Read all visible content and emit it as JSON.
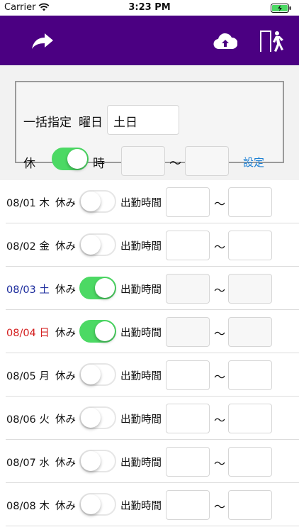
{
  "status_bar": {
    "carrier": "Carrier",
    "time": "3:23 PM"
  },
  "navbar": {
    "bg": "#4b0082",
    "icons": [
      "share-forward-icon",
      "cloud-upload-icon",
      "exit-door-icon"
    ]
  },
  "bulk": {
    "title": "一括指定",
    "weekday_label": "曜日",
    "weekday_value": "土日",
    "holiday_label": "休",
    "holiday_on": true,
    "time_label": "時",
    "start_value": "",
    "tilde": "～",
    "end_value": "",
    "set_label": "設定"
  },
  "rows": [
    {
      "date": "08/01",
      "dow": "木",
      "holiday_label": "休み",
      "holiday_on": false,
      "work_label": "出勤時間",
      "tilde": "～",
      "color": "normal"
    },
    {
      "date": "08/02",
      "dow": "金",
      "holiday_label": "休み",
      "holiday_on": false,
      "work_label": "出勤時間",
      "tilde": "～",
      "color": "normal"
    },
    {
      "date": "08/03",
      "dow": "土",
      "holiday_label": "休み",
      "holiday_on": true,
      "work_label": "出勤時間",
      "tilde": "～",
      "color": "blue"
    },
    {
      "date": "08/04",
      "dow": "日",
      "holiday_label": "休み",
      "holiday_on": true,
      "work_label": "出勤時間",
      "tilde": "～",
      "color": "red"
    },
    {
      "date": "08/05",
      "dow": "月",
      "holiday_label": "休み",
      "holiday_on": false,
      "work_label": "出勤時間",
      "tilde": "～",
      "color": "normal"
    },
    {
      "date": "08/06",
      "dow": "火",
      "holiday_label": "休み",
      "holiday_on": false,
      "work_label": "出勤時間",
      "tilde": "～",
      "color": "normal"
    },
    {
      "date": "08/07",
      "dow": "水",
      "holiday_label": "休み",
      "holiday_on": false,
      "work_label": "出勤時間",
      "tilde": "～",
      "color": "normal"
    },
    {
      "date": "08/08",
      "dow": "木",
      "holiday_label": "休み",
      "holiday_on": false,
      "work_label": "出勤時間",
      "tilde": "～",
      "color": "normal"
    }
  ]
}
